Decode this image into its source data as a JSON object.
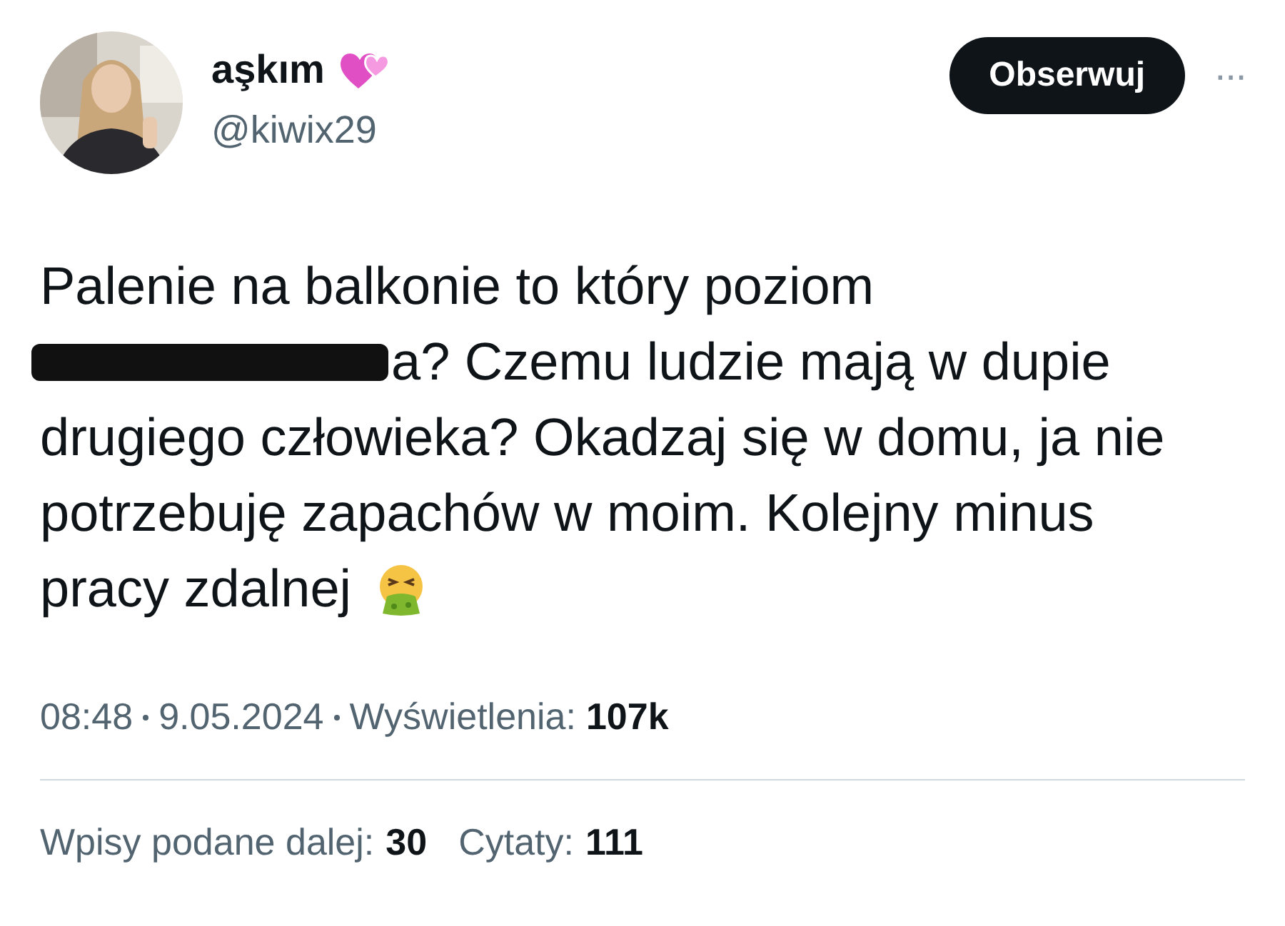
{
  "author": {
    "display_name": "aşkım",
    "handle": "@kiwix29"
  },
  "follow_button": {
    "label": "Obserwuj"
  },
  "more_button": {
    "label": "···"
  },
  "tweet": {
    "first_line": "Palenie na balkonie to który poziom",
    "redacted": true,
    "after_redaction": "a? Czemu ludzie mają w dupie",
    "rest_lines": [
      "drugiego człowieka? Okadzaj się w domu, ja nie",
      "potrzebuję zapachów w moim. Kolejny minus",
      "pracy zdalnej"
    ]
  },
  "meta": {
    "time": "08:48",
    "date": "9.05.2024",
    "views_label": "Wyświetlenia:",
    "views_count": "107k"
  },
  "stats": [
    {
      "label": "Wpisy podane dalej:",
      "count": "30"
    },
    {
      "label": "Cytaty:",
      "count": "111"
    }
  ]
}
